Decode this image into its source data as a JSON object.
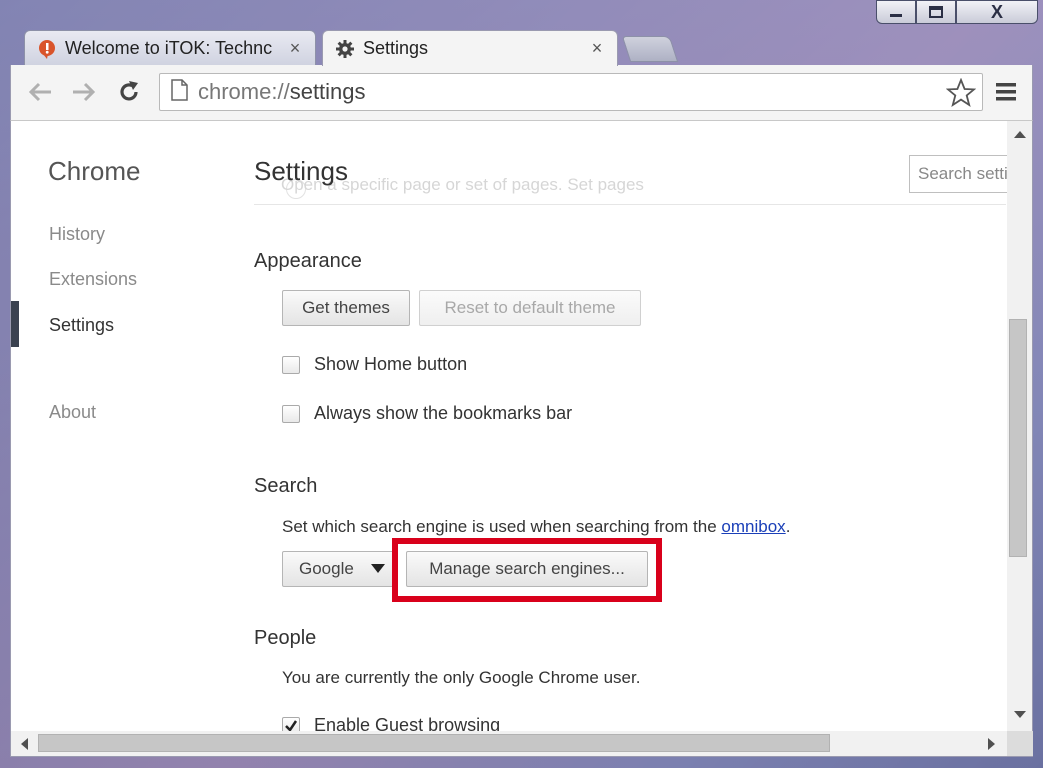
{
  "window": {
    "controls": {
      "minimize": "▁",
      "maximize": "▢",
      "close": "X"
    }
  },
  "tabs": [
    {
      "title": "Welcome to iTOK: Technc",
      "icon": "itok-favicon-icon",
      "close": "×",
      "active": false
    },
    {
      "title": "Settings",
      "icon": "gear-icon",
      "close": "×",
      "active": true
    }
  ],
  "toolbar": {
    "url_scheme": "chrome://",
    "url_path": "settings",
    "icons": [
      "back-arrow-icon",
      "forward-arrow-icon",
      "reload-icon",
      "page-icon",
      "star-icon",
      "hamburger-menu-icon"
    ]
  },
  "sidebar": {
    "title": "Chrome",
    "items": [
      {
        "label": "History",
        "selected": false
      },
      {
        "label": "Extensions",
        "selected": false
      },
      {
        "label": "Settings",
        "selected": true
      },
      {
        "label": "About",
        "selected": false
      }
    ]
  },
  "main": {
    "title": "Settings",
    "search_placeholder": "Search setti",
    "ghost_text": "Open a specific page or set of pages. Set pages",
    "appearance": {
      "heading": "Appearance",
      "get_themes": "Get themes",
      "reset_theme": "Reset to default theme",
      "show_home": {
        "label": "Show Home button",
        "checked": false
      },
      "bookmarks_bar": {
        "label": "Always show the bookmarks bar",
        "checked": false
      }
    },
    "search": {
      "heading": "Search",
      "description": "Set which search engine is used when searching from the ",
      "link": "omnibox",
      "period": ".",
      "engine": "Google",
      "manage": "Manage search engines..."
    },
    "people": {
      "heading": "People",
      "description": "You are currently the only Google Chrome user.",
      "guest": {
        "label": "Enable Guest browsing",
        "checked": true
      }
    }
  },
  "colors": {
    "highlight": "#d9001b",
    "link": "#1a3fb8",
    "nav_indicator": "#3b4250"
  }
}
